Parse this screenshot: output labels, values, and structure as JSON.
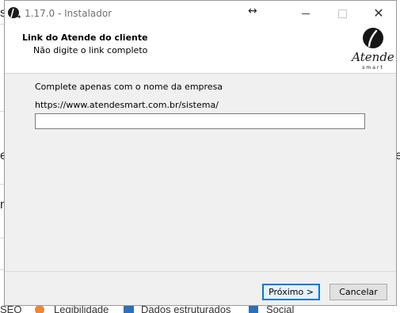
{
  "window": {
    "title": "1.17.0 - Instalador",
    "minimize_label": "",
    "close_symbol": "✕"
  },
  "header": {
    "title": "Link do Atende do cliente",
    "subtitle": "Não digite o link completo",
    "logo": {
      "icon": "atende-smart-logo",
      "text": "Atende",
      "subtext": "smart"
    }
  },
  "form": {
    "instruction": "Complete apenas com o nome da empresa",
    "url_prefix": "https://www.atendesmart.com.br/sistema/",
    "company_input": {
      "value": "",
      "placeholder": ""
    }
  },
  "buttons": {
    "next_label": "Próximo >",
    "cancel_label": "Cancelar"
  },
  "background": {
    "frag_s": "s",
    "frag_e1": "e",
    "frag_e2": "e",
    "frag_n": "n",
    "bottom_items": [
      "SEO",
      "Legibilidade",
      "Dados estruturados",
      "Social"
    ]
  },
  "colors": {
    "accent": "#0078d7",
    "dialog_bg": "#f0f0f0",
    "header_bg": "#ffffff"
  }
}
